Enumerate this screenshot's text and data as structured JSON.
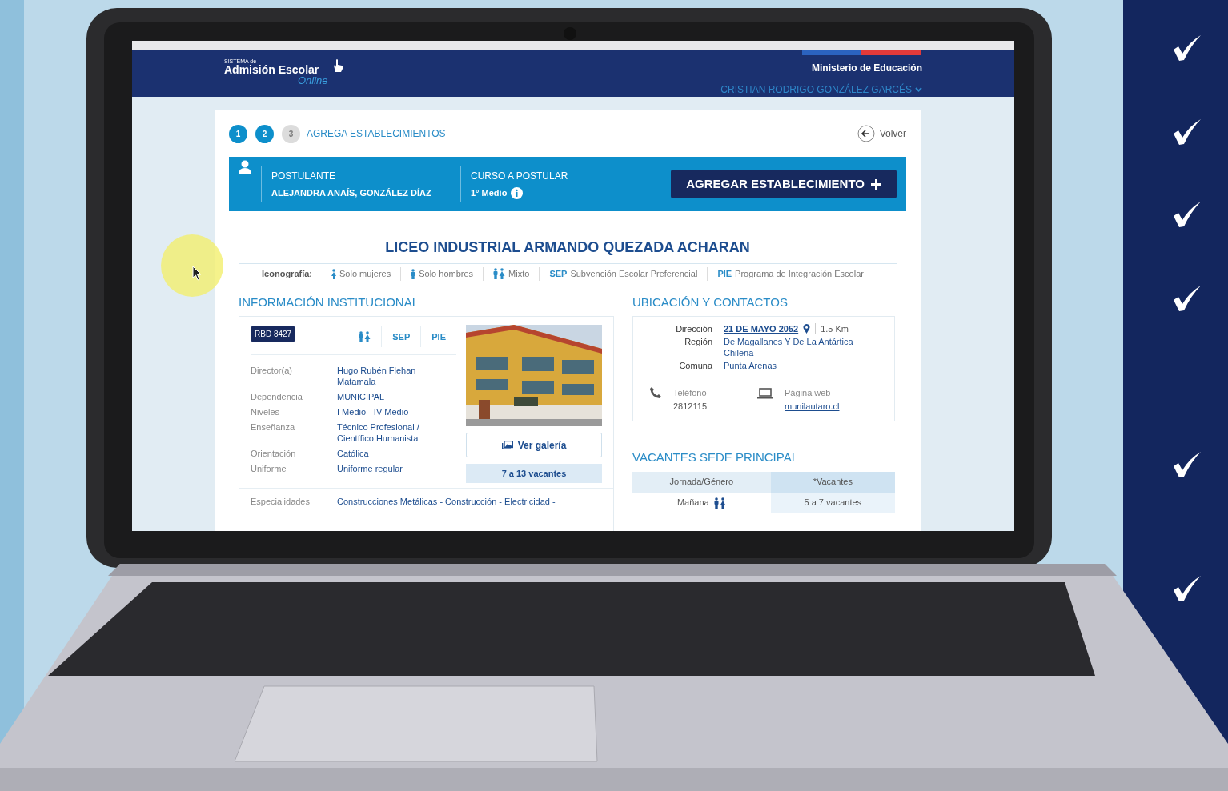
{
  "header": {
    "logo": {
      "small": "SISTEMA de",
      "main": "Admisión Escolar",
      "script": "Online"
    },
    "ministry": "Ministerio de Educación",
    "user": "CRISTIAN RODRIGO GONZÁLEZ GARCÉS"
  },
  "steps": [
    {
      "label": "1",
      "done": true
    },
    {
      "label": "2",
      "done": true
    },
    {
      "label": "3",
      "done": false
    }
  ],
  "step_title": "AGREGA ESTABLECIMIENTOS",
  "back": "Volver",
  "applicant": {
    "label": "POSTULANTE",
    "name": "ALEJANDRA ANAÍS, GONZÁLEZ DÍAZ",
    "course_label": "CURSO A POSTULAR",
    "course": "1° Medio",
    "button": "AGREGAR ESTABLECIMIENTO"
  },
  "school_title": "LICEO INDUSTRIAL ARMANDO QUEZADA ACHARAN",
  "iconography": {
    "label": "Iconografía:",
    "items": [
      {
        "kind": "female",
        "text": "Solo mujeres"
      },
      {
        "kind": "male",
        "text": "Solo hombres"
      },
      {
        "kind": "mixed",
        "text": "Mixto"
      },
      {
        "kind": "code",
        "code": "SEP",
        "text": "Subvención Escolar Preferencial"
      },
      {
        "kind": "code",
        "code": "PIE",
        "text": "Programa de Integración Escolar"
      }
    ]
  },
  "info": {
    "heading": "INFORMACIÓN INSTITUCIONAL",
    "rbd": "RBD 8427",
    "badges": [
      {
        "kind": "mixed"
      },
      {
        "kind": "code",
        "text": "SEP"
      },
      {
        "kind": "code",
        "text": "PIE"
      }
    ],
    "fields": [
      {
        "label": "Director(a)",
        "value": "Hugo Rubén Flehan Matamala"
      },
      {
        "label": "Dependencia",
        "value": "MUNICIPAL"
      },
      {
        "label": "Niveles",
        "value": "I Medio - IV Medio"
      },
      {
        "label": "Enseñanza",
        "value": "Técnico Profesional / Científico Humanista"
      },
      {
        "label": "Orientación",
        "value": "Católica"
      },
      {
        "label": "Uniforme",
        "value": "Uniforme regular"
      }
    ],
    "gallery": "Ver galería",
    "vacancies": "7 a 13 vacantes",
    "specialties_label": "Especialidades",
    "specialties": "Construcciones Metálicas - Construcción - Electricidad -"
  },
  "location": {
    "heading": "UBICACIÓN Y CONTACTOS",
    "rows": [
      {
        "label": "Dirección",
        "value": "21 DE MAYO 2052",
        "kind": "address",
        "distance": "1.5 Km"
      },
      {
        "label": "Región",
        "value": "De Magallanes Y De La Antártica Chilena",
        "kind": "text"
      },
      {
        "label": "Comuna",
        "value": "Punta Arenas",
        "kind": "text"
      }
    ],
    "phone_label": "Teléfono",
    "phone": "2812115",
    "web_label": "Página web",
    "web": "munilautaro.cl"
  },
  "vacancies": {
    "heading": "VACANTES SEDE PRINCIPAL",
    "columns": [
      "Jornada/Género",
      "*Vacantes"
    ],
    "rows": [
      {
        "shift": "Mañana",
        "kind": "mixed",
        "vacancies": "5 a 7 vacantes"
      }
    ]
  }
}
